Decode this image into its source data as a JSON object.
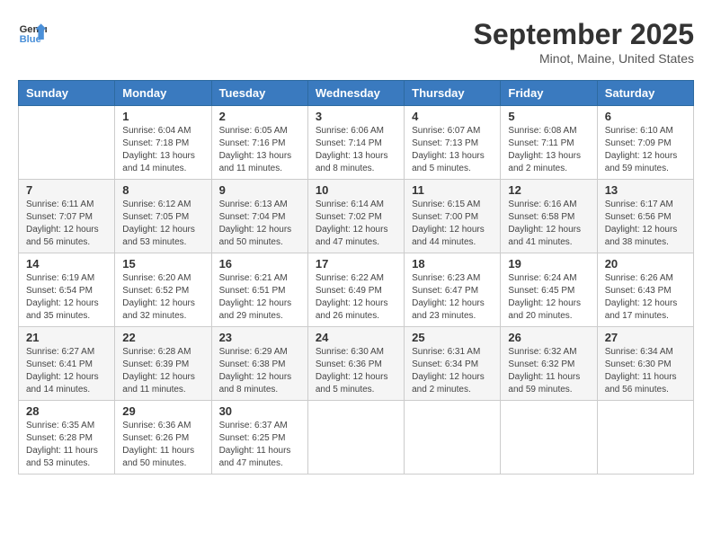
{
  "header": {
    "logo_line1": "General",
    "logo_line2": "Blue",
    "month": "September 2025",
    "location": "Minot, Maine, United States"
  },
  "days_of_week": [
    "Sunday",
    "Monday",
    "Tuesday",
    "Wednesday",
    "Thursday",
    "Friday",
    "Saturday"
  ],
  "weeks": [
    [
      {
        "day": "",
        "info": ""
      },
      {
        "day": "1",
        "info": "Sunrise: 6:04 AM\nSunset: 7:18 PM\nDaylight: 13 hours\nand 14 minutes."
      },
      {
        "day": "2",
        "info": "Sunrise: 6:05 AM\nSunset: 7:16 PM\nDaylight: 13 hours\nand 11 minutes."
      },
      {
        "day": "3",
        "info": "Sunrise: 6:06 AM\nSunset: 7:14 PM\nDaylight: 13 hours\nand 8 minutes."
      },
      {
        "day": "4",
        "info": "Sunrise: 6:07 AM\nSunset: 7:13 PM\nDaylight: 13 hours\nand 5 minutes."
      },
      {
        "day": "5",
        "info": "Sunrise: 6:08 AM\nSunset: 7:11 PM\nDaylight: 13 hours\nand 2 minutes."
      },
      {
        "day": "6",
        "info": "Sunrise: 6:10 AM\nSunset: 7:09 PM\nDaylight: 12 hours\nand 59 minutes."
      }
    ],
    [
      {
        "day": "7",
        "info": "Sunrise: 6:11 AM\nSunset: 7:07 PM\nDaylight: 12 hours\nand 56 minutes."
      },
      {
        "day": "8",
        "info": "Sunrise: 6:12 AM\nSunset: 7:05 PM\nDaylight: 12 hours\nand 53 minutes."
      },
      {
        "day": "9",
        "info": "Sunrise: 6:13 AM\nSunset: 7:04 PM\nDaylight: 12 hours\nand 50 minutes."
      },
      {
        "day": "10",
        "info": "Sunrise: 6:14 AM\nSunset: 7:02 PM\nDaylight: 12 hours\nand 47 minutes."
      },
      {
        "day": "11",
        "info": "Sunrise: 6:15 AM\nSunset: 7:00 PM\nDaylight: 12 hours\nand 44 minutes."
      },
      {
        "day": "12",
        "info": "Sunrise: 6:16 AM\nSunset: 6:58 PM\nDaylight: 12 hours\nand 41 minutes."
      },
      {
        "day": "13",
        "info": "Sunrise: 6:17 AM\nSunset: 6:56 PM\nDaylight: 12 hours\nand 38 minutes."
      }
    ],
    [
      {
        "day": "14",
        "info": "Sunrise: 6:19 AM\nSunset: 6:54 PM\nDaylight: 12 hours\nand 35 minutes."
      },
      {
        "day": "15",
        "info": "Sunrise: 6:20 AM\nSunset: 6:52 PM\nDaylight: 12 hours\nand 32 minutes."
      },
      {
        "day": "16",
        "info": "Sunrise: 6:21 AM\nSunset: 6:51 PM\nDaylight: 12 hours\nand 29 minutes."
      },
      {
        "day": "17",
        "info": "Sunrise: 6:22 AM\nSunset: 6:49 PM\nDaylight: 12 hours\nand 26 minutes."
      },
      {
        "day": "18",
        "info": "Sunrise: 6:23 AM\nSunset: 6:47 PM\nDaylight: 12 hours\nand 23 minutes."
      },
      {
        "day": "19",
        "info": "Sunrise: 6:24 AM\nSunset: 6:45 PM\nDaylight: 12 hours\nand 20 minutes."
      },
      {
        "day": "20",
        "info": "Sunrise: 6:26 AM\nSunset: 6:43 PM\nDaylight: 12 hours\nand 17 minutes."
      }
    ],
    [
      {
        "day": "21",
        "info": "Sunrise: 6:27 AM\nSunset: 6:41 PM\nDaylight: 12 hours\nand 14 minutes."
      },
      {
        "day": "22",
        "info": "Sunrise: 6:28 AM\nSunset: 6:39 PM\nDaylight: 12 hours\nand 11 minutes."
      },
      {
        "day": "23",
        "info": "Sunrise: 6:29 AM\nSunset: 6:38 PM\nDaylight: 12 hours\nand 8 minutes."
      },
      {
        "day": "24",
        "info": "Sunrise: 6:30 AM\nSunset: 6:36 PM\nDaylight: 12 hours\nand 5 minutes."
      },
      {
        "day": "25",
        "info": "Sunrise: 6:31 AM\nSunset: 6:34 PM\nDaylight: 12 hours\nand 2 minutes."
      },
      {
        "day": "26",
        "info": "Sunrise: 6:32 AM\nSunset: 6:32 PM\nDaylight: 11 hours\nand 59 minutes."
      },
      {
        "day": "27",
        "info": "Sunrise: 6:34 AM\nSunset: 6:30 PM\nDaylight: 11 hours\nand 56 minutes."
      }
    ],
    [
      {
        "day": "28",
        "info": "Sunrise: 6:35 AM\nSunset: 6:28 PM\nDaylight: 11 hours\nand 53 minutes."
      },
      {
        "day": "29",
        "info": "Sunrise: 6:36 AM\nSunset: 6:26 PM\nDaylight: 11 hours\nand 50 minutes."
      },
      {
        "day": "30",
        "info": "Sunrise: 6:37 AM\nSunset: 6:25 PM\nDaylight: 11 hours\nand 47 minutes."
      },
      {
        "day": "",
        "info": ""
      },
      {
        "day": "",
        "info": ""
      },
      {
        "day": "",
        "info": ""
      },
      {
        "day": "",
        "info": ""
      }
    ]
  ]
}
